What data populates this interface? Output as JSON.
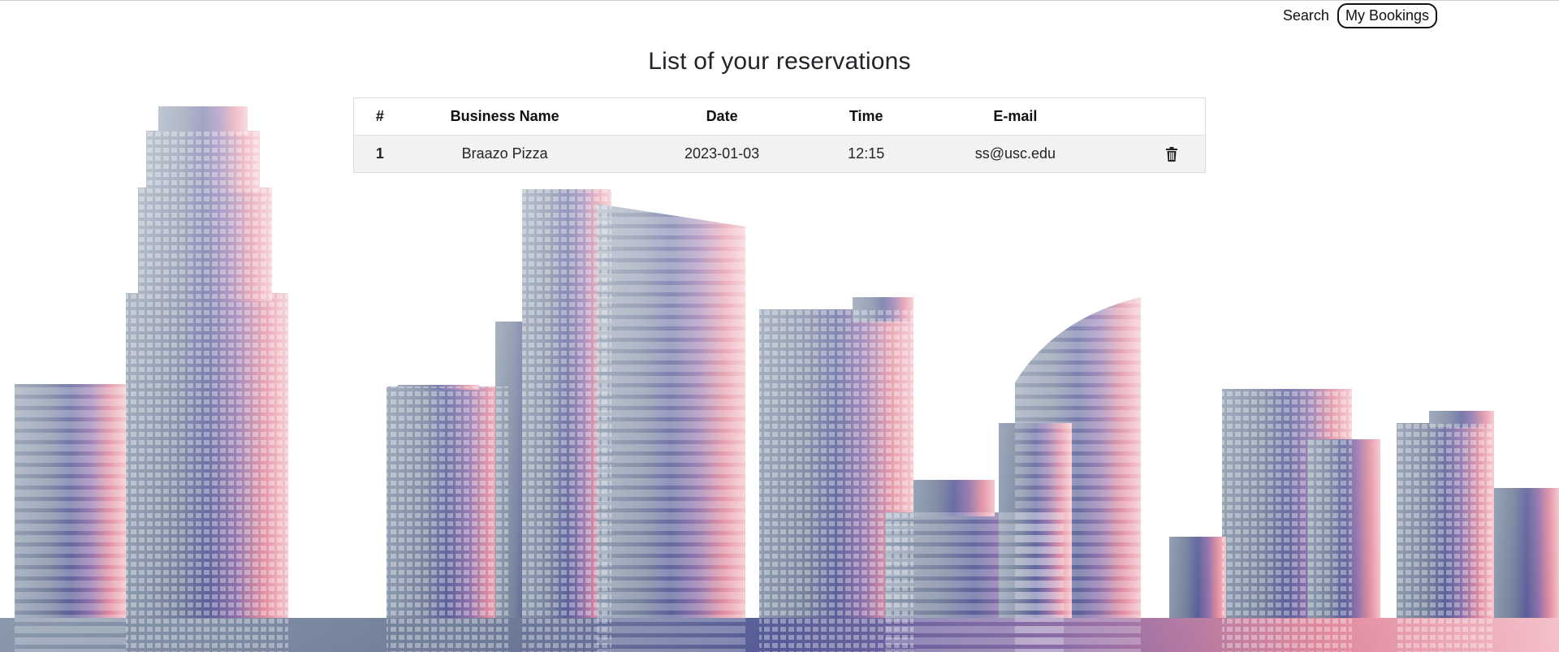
{
  "nav": {
    "search_label": "Search",
    "bookings_label": "My Bookings"
  },
  "page": {
    "title": "List of your reservations"
  },
  "table": {
    "headers": [
      "#",
      "Business Name",
      "Date",
      "Time",
      "E-mail",
      ""
    ],
    "rows": [
      {
        "num": "1",
        "business": "Braazo Pizza",
        "date": "2023-01-03",
        "time": "12:15",
        "email": "ss@usc.edu",
        "action_icon": "trash-icon"
      }
    ]
  },
  "colors": {
    "background": "#ffffff",
    "row_background": "#f2f2f2",
    "skyline_left": "#5d6f87",
    "skyline_mid": "#4b4f88",
    "skyline_right": "#e07a92"
  }
}
